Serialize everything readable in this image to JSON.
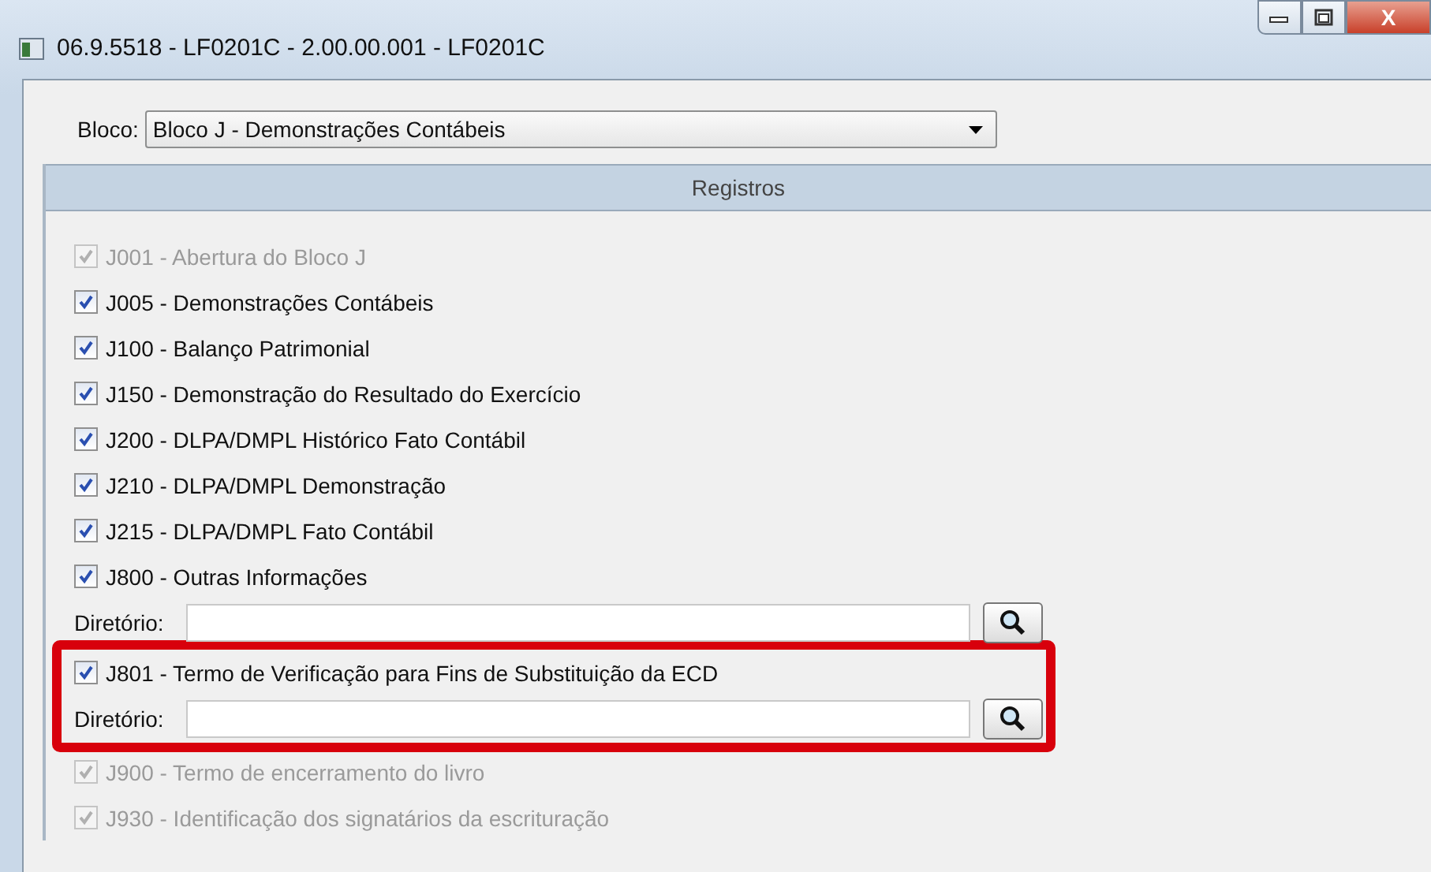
{
  "window": {
    "title": "06.9.5518 - LF0201C - 2.00.00.001 - LF0201C",
    "close_label": "X"
  },
  "bloco": {
    "label": "Bloco:",
    "value": "Bloco J - Demonstrações Contábeis"
  },
  "registros": {
    "header": "Registros",
    "rows": [
      {
        "kind": "record",
        "text": "J001 - Abertura do Bloco J",
        "checked": true,
        "disabled": true
      },
      {
        "kind": "record",
        "text": "J005 - Demonstrações Contábeis",
        "checked": true,
        "disabled": false
      },
      {
        "kind": "record",
        "text": "J100 - Balanço Patrimonial",
        "checked": true,
        "disabled": false
      },
      {
        "kind": "record",
        "text": "J150 - Demonstração do Resultado do Exercício",
        "checked": true,
        "disabled": false
      },
      {
        "kind": "record",
        "text": "J200 - DLPA/DMPL Histórico Fato Contábil",
        "checked": true,
        "disabled": false
      },
      {
        "kind": "record",
        "text": "J210 - DLPA/DMPL Demonstração",
        "checked": true,
        "disabled": false
      },
      {
        "kind": "record",
        "text": "J215 - DLPA/DMPL Fato Contábil",
        "checked": true,
        "disabled": false
      },
      {
        "kind": "record",
        "text": "J800 - Outras Informações",
        "checked": true,
        "disabled": false
      },
      {
        "kind": "directory",
        "label": "Diretório:"
      },
      {
        "kind": "highlight",
        "rows": [
          {
            "kind": "record",
            "text": "J801 - Termo de Verificação para Fins de Substituição da ECD",
            "checked": true,
            "disabled": false
          },
          {
            "kind": "directory",
            "label": "Diretório:"
          }
        ]
      },
      {
        "kind": "record",
        "text": "J900 - Termo de encerramento do livro",
        "checked": true,
        "disabled": true
      },
      {
        "kind": "record",
        "text": "J930 - Identificação dos signatários da escrituração",
        "checked": true,
        "disabled": true
      }
    ]
  }
}
